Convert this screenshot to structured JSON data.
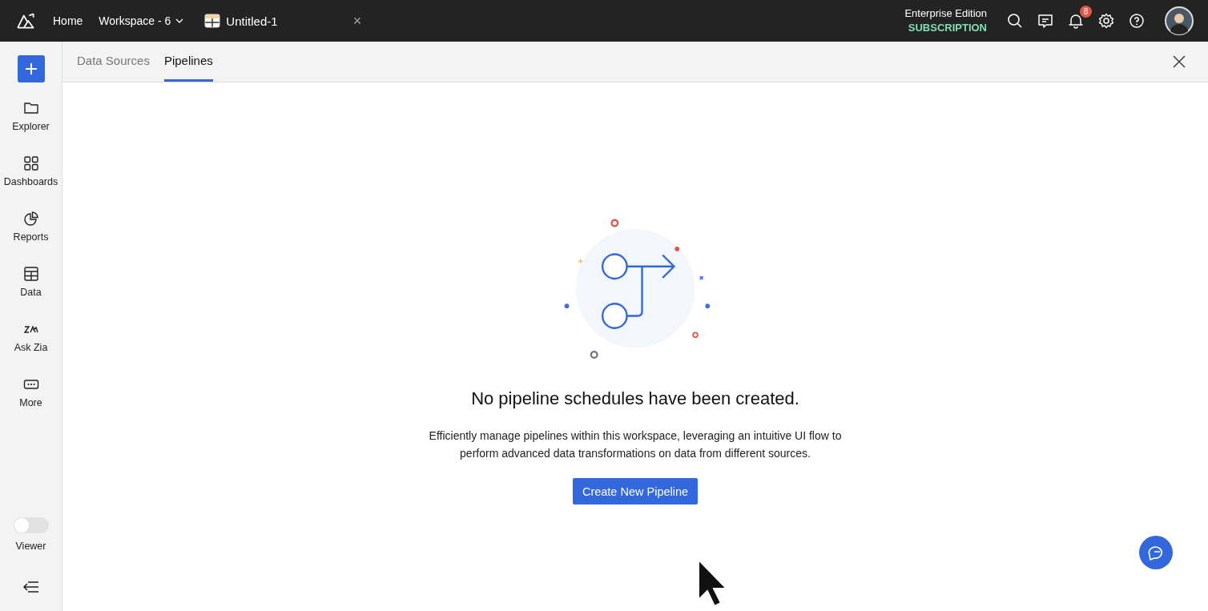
{
  "topbar": {
    "nav": [
      {
        "label": "Home",
        "kind": "link"
      },
      {
        "label": "Workspace - 6",
        "kind": "dropdown"
      }
    ],
    "doc_tab": {
      "title": "Untitled-1",
      "close": "×"
    },
    "edition": "Enterprise Edition",
    "subscription": "SUBSCRIPTION",
    "notifications": "8"
  },
  "sidebar": {
    "items": [
      {
        "label": "Explorer",
        "kind": "folder"
      },
      {
        "label": "Dashboards",
        "kind": "grid"
      },
      {
        "label": "Reports",
        "kind": "pie"
      },
      {
        "label": "Data",
        "kind": "table"
      },
      {
        "label": "Ask Zia",
        "kind": "zia"
      },
      {
        "label": "More",
        "kind": "more"
      }
    ],
    "viewer": {
      "label": "Viewer",
      "on": false
    }
  },
  "tabs": [
    {
      "label": "Data Sources",
      "selected": false
    },
    {
      "label": "Pipelines",
      "selected": true
    }
  ],
  "empty_state": {
    "title": "No pipeline schedules have been created.",
    "description": "Efficiently manage pipelines within this workspace, leveraging an intuitive UI flow to perform advanced data transformations on data from different sources.",
    "button": "Create New Pipeline"
  }
}
